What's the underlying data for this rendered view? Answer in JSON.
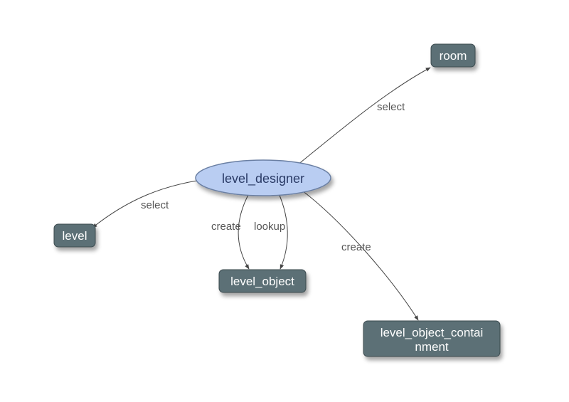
{
  "nodes": {
    "level_designer": {
      "label": "level_designer"
    },
    "room": {
      "label": "room"
    },
    "level": {
      "label": "level"
    },
    "level_object": {
      "label": "level_object"
    },
    "level_object_containment": {
      "label": "level_object_contai",
      "label2": "nment"
    }
  },
  "edges": {
    "to_room": {
      "label": "select"
    },
    "to_level": {
      "label": "select"
    },
    "to_level_object_create": {
      "label": "create"
    },
    "to_level_object_lookup": {
      "label": "lookup"
    },
    "to_containment": {
      "label": "create"
    }
  }
}
